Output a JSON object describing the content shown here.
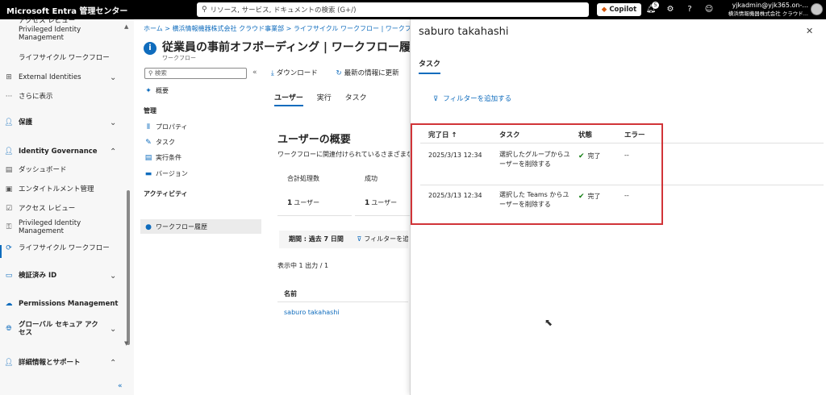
{
  "topbar": {
    "brand": "Microsoft Entra 管理センター",
    "search_placeholder": "リソース, サービス, ドキュメントの検索 (G+/)",
    "copilot_label": "Copilot",
    "notification_count": "5",
    "account_name": "yjkadmin@yjk365.on-...",
    "account_org": "横浜情報機器株式会社 クラウド..."
  },
  "leftnav": {
    "items": [
      {
        "label": "アクセス レビュー"
      },
      {
        "label": "Privileged Identity Management"
      },
      {
        "label": "ライフサイクル ワークフロー"
      },
      {
        "label": "External Identities"
      },
      {
        "label": "さらに表示"
      },
      {
        "label": "保護"
      },
      {
        "label": "Identity Governance"
      },
      {
        "label": "ダッシュボード"
      },
      {
        "label": "エンタイトルメント管理"
      },
      {
        "label": "アクセス レビュー"
      },
      {
        "label": "Privileged Identity Management"
      },
      {
        "label": "ライフサイクル ワークフロー"
      },
      {
        "label": "検証済み ID"
      },
      {
        "label": "Permissions Management"
      },
      {
        "label": "グローバル セキュア アクセス"
      },
      {
        "label": "詳細情報とサポート"
      }
    ]
  },
  "main": {
    "breadcrumb": "ホーム > 横浜情報機器株式会社 クラウド事業部 > ライフサイクル ワークフロー | ワークフロー >",
    "title": "従業員の事前オフボーディング | ワークフロー履歴",
    "subtitle": "ワークフロー",
    "subnav": {
      "search_placeholder": "検索",
      "overview": "概要",
      "manage_heading": "管理",
      "properties": "プロパティ",
      "tasks": "タスク",
      "conditions": "実行条件",
      "versions": "バージョン",
      "activity_heading": "アクティビティ",
      "history": "ワークフロー履歴"
    },
    "toolbar": {
      "download": "ダウンロード",
      "refresh": "最新の情報に更新"
    },
    "tabs": [
      "ユーザー",
      "実行",
      "タスク"
    ],
    "summary_title": "ユーザーの概要",
    "summary_desc": "ワークフローに関連付けられているさまざまな",
    "cards": [
      {
        "label": "合計処理数",
        "value": "1",
        "unit": "ユーザー"
      },
      {
        "label": "成功",
        "value": "1",
        "unit": "ユーザー"
      }
    ],
    "period_label": "期間 : 過去 7 日間",
    "add_filter": "フィルターを追",
    "results_count": "表示中 1 出力 / 1",
    "users_header": "名前",
    "user_name": "saburo takahashi"
  },
  "panel": {
    "title": "saburo takahashi",
    "tab": "タスク",
    "add_filter": "フィルターを追加する",
    "columns": [
      "完了日 ↑",
      "タスク",
      "状態",
      "エラー"
    ],
    "rows": [
      {
        "date": "2025/3/13 12:34",
        "task": "選択したグループからユーザーを削除する",
        "status": "完了",
        "error": "--"
      },
      {
        "date": "2025/3/13 12:34",
        "task": "選択した Teams からユーザーを削除する",
        "status": "完了",
        "error": "--"
      }
    ]
  },
  "colors": {
    "accent": "#0f6cbd",
    "success": "#107c10",
    "highlight": "#d13438"
  }
}
